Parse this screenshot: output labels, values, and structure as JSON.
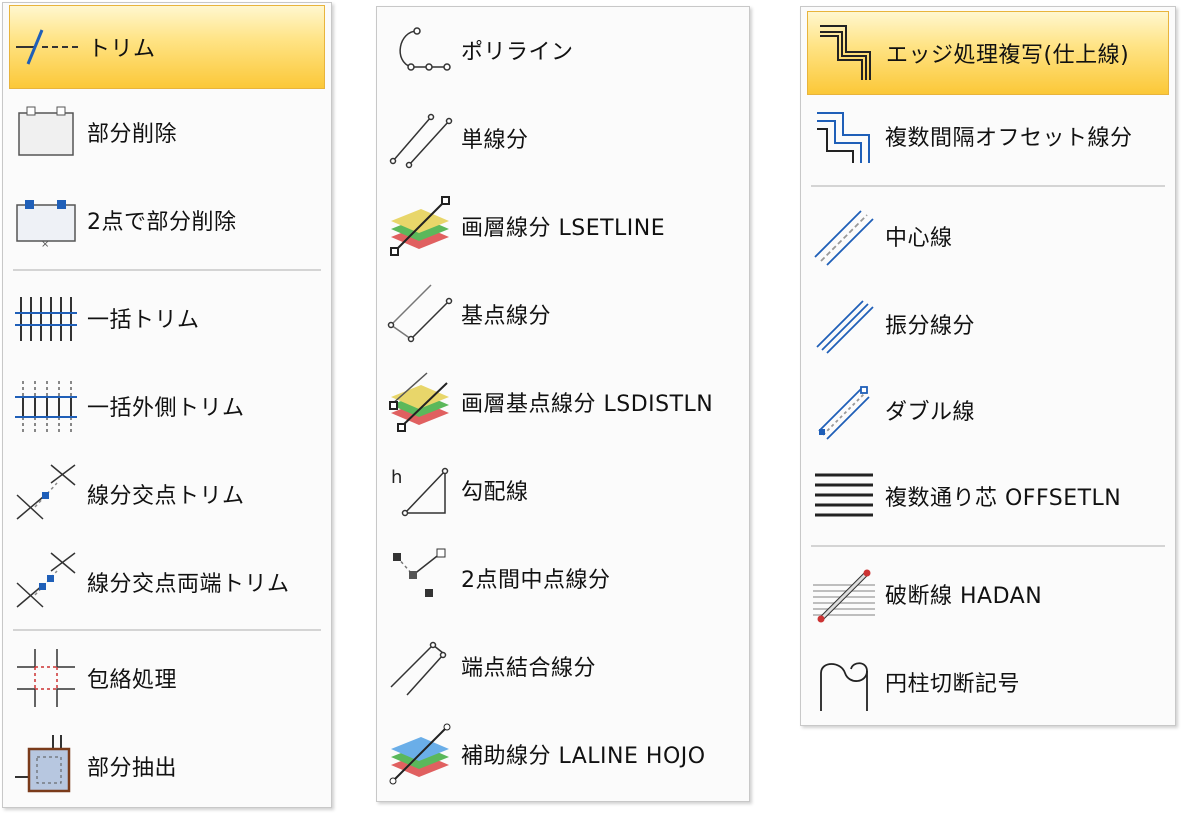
{
  "trim_menu": {
    "items": [
      {
        "label": "トリム",
        "icon": "trim-icon"
      },
      {
        "label": "部分削除",
        "icon": "partial-delete-icon"
      },
      {
        "label": "2点で部分削除",
        "icon": "two-point-partial-delete-icon"
      },
      {
        "label": "一括トリム",
        "icon": "batch-trim-icon"
      },
      {
        "label": "一括外側トリム",
        "icon": "batch-outer-trim-icon"
      },
      {
        "label": "線分交点トリム",
        "icon": "segment-intersection-trim-icon"
      },
      {
        "label": "線分交点両端トリム",
        "icon": "segment-intersection-both-ends-trim-icon"
      },
      {
        "label": "包絡処理",
        "icon": "envelope-process-icon"
      },
      {
        "label": "部分抽出",
        "icon": "partial-extract-icon"
      }
    ]
  },
  "line_menu": {
    "items": [
      {
        "label": "ポリライン",
        "icon": "polyline-icon"
      },
      {
        "label": "単線分",
        "icon": "single-line-icon"
      },
      {
        "label": "画層線分 LSETLINE",
        "icon": "layer-line-icon"
      },
      {
        "label": "基点線分",
        "icon": "base-point-line-icon"
      },
      {
        "label": "画層基点線分 LSDISTLN",
        "icon": "layer-base-point-line-icon"
      },
      {
        "label": "勾配線",
        "icon": "slope-line-icon"
      },
      {
        "label": "2点間中点線分",
        "icon": "midpoint-line-icon"
      },
      {
        "label": "端点結合線分",
        "icon": "endpoint-join-line-icon"
      },
      {
        "label": "補助線分 LALINE HOJO",
        "icon": "auxiliary-line-icon"
      }
    ]
  },
  "offset_menu": {
    "items": [
      {
        "label": "エッジ処理複写(仕上線)",
        "icon": "edge-copy-icon"
      },
      {
        "label": "複数間隔オフセット線分",
        "icon": "multi-interval-offset-icon"
      },
      {
        "label": "中心線",
        "icon": "center-line-icon"
      },
      {
        "label": "振分線分",
        "icon": "split-line-icon"
      },
      {
        "label": "ダブル線",
        "icon": "double-line-icon"
      },
      {
        "label": "複数通り芯 OFFSETLN",
        "icon": "multi-grid-line-icon"
      },
      {
        "label": "破断線 HADAN",
        "icon": "break-line-icon"
      },
      {
        "label": "円柱切断記号",
        "icon": "cylinder-cut-symbol-icon"
      }
    ]
  },
  "colors": {
    "highlight": "#fbc838",
    "accent_blue": "#1f5fb8",
    "separator": "#d4d4d4"
  }
}
